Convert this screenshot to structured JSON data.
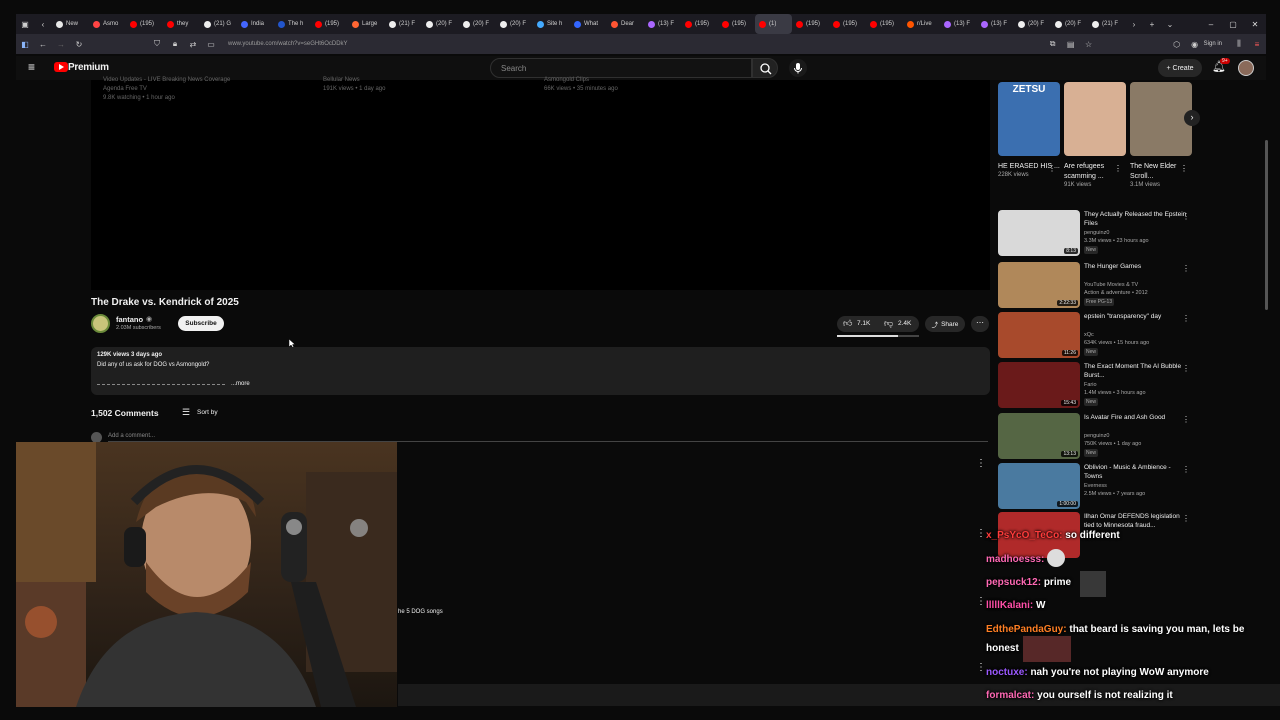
{
  "browser": {
    "tabs": [
      {
        "label": "New",
        "color": "#e8e8e8"
      },
      {
        "label": "Asmo",
        "color": "#ff4444"
      },
      {
        "label": "(195)",
        "color": "#ff0000"
      },
      {
        "label": "they",
        "color": "#ff0000"
      },
      {
        "label": "(21) G",
        "color": "#eeeeee"
      },
      {
        "label": "India",
        "color": "#4466ff"
      },
      {
        "label": "The h",
        "color": "#2255cc"
      },
      {
        "label": "(195)",
        "color": "#ff0000"
      },
      {
        "label": "Large",
        "color": "#ff6633"
      },
      {
        "label": "(21) F",
        "color": "#eeeeee"
      },
      {
        "label": "(20) F",
        "color": "#eeeeee"
      },
      {
        "label": "(20) F",
        "color": "#eeeeee"
      },
      {
        "label": "(20) F",
        "color": "#eeeeee"
      },
      {
        "label": "Site h",
        "color": "#44aaff"
      },
      {
        "label": "What",
        "color": "#3366ff"
      },
      {
        "label": "Dear",
        "color": "#ff5533"
      },
      {
        "label": "(13) F",
        "color": "#aa66ff"
      },
      {
        "label": "(195)",
        "color": "#ff0000"
      },
      {
        "label": "(195)",
        "color": "#ff0000"
      },
      {
        "label": "(1)",
        "color": "#ff0000"
      },
      {
        "label": "(195)",
        "color": "#ff0000"
      },
      {
        "label": "(195)",
        "color": "#ff0000"
      },
      {
        "label": "(195)",
        "color": "#ff0000"
      },
      {
        "label": "r/Live",
        "color": "#ff5500"
      },
      {
        "label": "(13) F",
        "color": "#aa66ff"
      },
      {
        "label": "(13) F",
        "color": "#aa66ff"
      },
      {
        "label": "(20) F",
        "color": "#eeeeee"
      },
      {
        "label": "(20) F",
        "color": "#eeeeee"
      },
      {
        "label": "(21) F",
        "color": "#eeeeee"
      }
    ],
    "url": "www.youtube.com/watch?v=seGHt6OcDDkY",
    "signin": "Sign in"
  },
  "yt": {
    "brand": "Premium",
    "search_placeholder": "Search",
    "create_label": "Create",
    "notif_count": "9+",
    "video_meta": [
      {
        "l1": "Video Updates - LIVE Breaking News Coverage",
        "l2": "Agenda Free TV",
        "l3": "9.8K watching • 1 hour ago"
      },
      {
        "l1": "Bellular News",
        "l2": "",
        "l3": "191K views • 1 day ago"
      },
      {
        "l1": "Asmongold Clips",
        "l2": "",
        "l3": "66K views • 35 minutes ago"
      }
    ],
    "video_title": "The Drake vs. Kendrick of 2025",
    "channel": "fantano",
    "subscribers": "2.03M subscribers",
    "subscribe_label": "Subscribe",
    "likes": "7.1K",
    "dislikes": "2.4K",
    "share_label": "Share",
    "desc_stats": "129K views  3 days ago",
    "desc_text": "Did any of us ask for DOG vs Asmongold?",
    "desc_more": "...more",
    "comments_count": "1,502 Comments",
    "sort_label": "Sort by",
    "add_comment": "Add a comment...",
    "comment_snippet": "he 5 DOG songs"
  },
  "sidebar": {
    "shorts": [
      {
        "title": "HE ERASED HIS ...",
        "views": "228K views",
        "color": "#3b6fb0",
        "label": "ZETSU"
      },
      {
        "title": "Are refugees scamming ...",
        "views": "91K views",
        "color": "#d8b094",
        "label": ""
      },
      {
        "title": "The New Elder Scroll...",
        "views": "3.1M views",
        "color": "#8a7a66",
        "label": ""
      }
    ],
    "recs": [
      {
        "title": "They Actually Released the Epstein Files",
        "channel": "penguinz0",
        "meta": "3.3M views • 23 hours ago",
        "badge": "New",
        "dur": "8:13",
        "color": "#d9d9d9"
      },
      {
        "title": "The Hunger Games",
        "channel": "YouTube Movies & TV",
        "meta": "Action & adventure • 2012",
        "badge": "Free  PG-13",
        "dur": "2:22:33",
        "color": "#b0885a"
      },
      {
        "title": "epstein \"transparency\" day",
        "channel": "xQc",
        "meta": "634K views • 15 hours ago",
        "badge": "New",
        "dur": "11:26",
        "color": "#a84a2c"
      },
      {
        "title": "The Exact Moment The AI Bubble Burst...",
        "channel": "Fario",
        "meta": "1.4M views • 3 hours ago",
        "badge": "New",
        "dur": "15:43",
        "color": "#6a1a1a"
      },
      {
        "title": "Is Avatar Fire and Ash Good",
        "channel": "penguinz0",
        "meta": "750K views • 1 day ago",
        "badge": "New",
        "dur": "13:13",
        "color": "#556644"
      },
      {
        "title": "Oblivion - Music & Ambience - Towns",
        "channel": "Everness",
        "meta": "2.5M views • 7 years ago",
        "badge": "",
        "dur": "1:00:00",
        "color": "#4a7aa0"
      },
      {
        "title": "Ilhan Omar DEFENDS legislation tied to Minnesota fraud...",
        "channel": "",
        "meta": "",
        "badge": "",
        "dur": "",
        "color": "#b02a2a"
      }
    ]
  },
  "chat": [
    {
      "user": "x_PsYcO_TeCo:",
      "msg": "so different",
      "color": "#ff3b3b"
    },
    {
      "user": "madhoesss:",
      "msg": "",
      "color": "#ff69b4"
    },
    {
      "user": "pepsuck12:",
      "msg": "prime",
      "color": "#ff69b4"
    },
    {
      "user": "lllllKalani:",
      "msg": "W",
      "color": "#ff4fa8"
    },
    {
      "user": "EdthePandaGuy:",
      "msg": "that beard is saving you man, lets be",
      "color": "#ff7f24"
    },
    {
      "user": "",
      "msg": "honest",
      "color": "#ffffff"
    },
    {
      "user": "noctuxe:",
      "msg": "nah you're not playing WoW anymore",
      "color": "#9b59ff"
    },
    {
      "user": "formalcat:",
      "msg": "you ourself is not realizing it",
      "color": "#ff69b4"
    }
  ]
}
